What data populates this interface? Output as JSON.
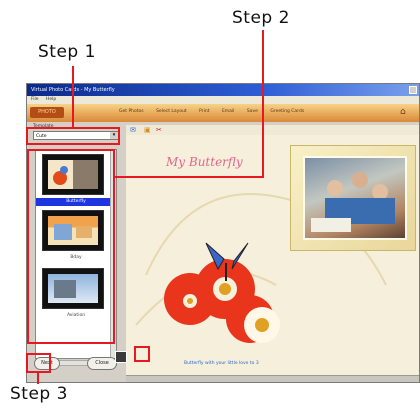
{
  "callouts": {
    "step1": "Step 1",
    "step2": "Step 2",
    "step3": "Step 3"
  },
  "app": {
    "window_title": "Virtual Photo Cards - My Butterfly",
    "menu": [
      "File",
      "Help"
    ],
    "brand": "PHOTO",
    "tabs": [
      "Get Photos",
      "Select Layout",
      "Print",
      "Email",
      "Save",
      "Greeting Cards"
    ],
    "template_filter": {
      "label": "Template",
      "value": "Cute"
    },
    "thumbnails": [
      {
        "caption": "Butterfly",
        "selected": true
      },
      {
        "caption": "Bday",
        "selected": false
      },
      {
        "caption": "Aviation",
        "selected": false
      }
    ],
    "buttons": {
      "next": "Next",
      "close": "Close"
    },
    "card": {
      "title": "My Butterfly",
      "caption": "Butterfly with your little love to 3"
    }
  },
  "colors": {
    "callout_red": "#e81820",
    "title_bar_blue": "#0a2a8a",
    "toolbar_orange": "#e8a95a",
    "card_background": "#f5efdc",
    "card_title_pink": "#e0668a",
    "selection_blue": "#1d36e0"
  }
}
